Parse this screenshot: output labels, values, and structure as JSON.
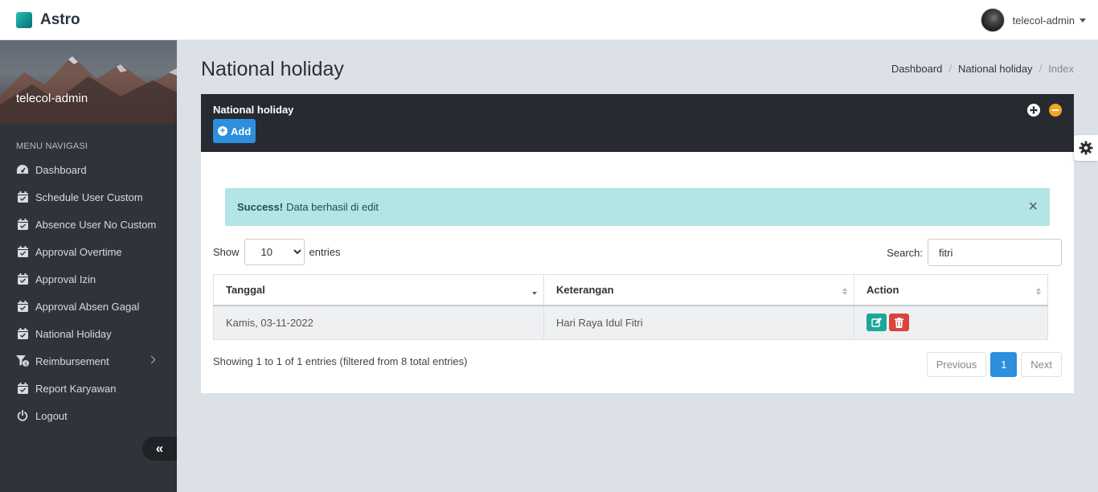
{
  "topbar": {
    "brand": "Astro",
    "user_name": "telecol-admin"
  },
  "sidebar": {
    "user_name": "telecol-admin",
    "menu_title": "MENU NAVIGASI",
    "items": [
      {
        "label": "Dashboard",
        "icon": "dashboard-icon"
      },
      {
        "label": "Schedule User Custom",
        "icon": "calendar-check-icon"
      },
      {
        "label": "Absence User No Custom",
        "icon": "calendar-check-icon"
      },
      {
        "label": "Approval Overtime",
        "icon": "calendar-check-icon"
      },
      {
        "label": "Approval Izin",
        "icon": "calendar-check-icon"
      },
      {
        "label": "Approval Absen Gagal",
        "icon": "calendar-check-icon"
      },
      {
        "label": "National Holiday",
        "icon": "calendar-check-icon"
      },
      {
        "label": "Reimbursement",
        "icon": "filter-dollar-icon"
      },
      {
        "label": "Report Karyawan",
        "icon": "calendar-check-icon"
      },
      {
        "label": "Logout",
        "icon": "power-icon"
      }
    ],
    "collapse_symbol": "«"
  },
  "page": {
    "title": "National holiday",
    "breadcrumb": [
      "Dashboard",
      "National holiday",
      "Index"
    ]
  },
  "card": {
    "title": "National holiday",
    "add_label": "Add"
  },
  "alert": {
    "strong": "Success!",
    "message": "Data berhasil di edit",
    "close": "×"
  },
  "table_controls": {
    "show_label": "Show",
    "entries_label": "entries",
    "page_length": "10",
    "search_label": "Search:",
    "search_value": "fitri"
  },
  "table": {
    "headers": [
      "Tanggal",
      "Keterangan",
      "Action"
    ],
    "rows": [
      {
        "tanggal": "Kamis, 03-11-2022",
        "keterangan": "Hari Raya Idul Fitri"
      }
    ]
  },
  "footer": {
    "info": "Showing 1 to 1 of 1 entries (filtered from 8 total entries)",
    "prev": "Previous",
    "page": "1",
    "next": "Next"
  },
  "colors": {
    "brand_teal": "#1ba89a",
    "primary_blue": "#2d8fdd",
    "alert_bg": "#b2e5e4",
    "danger": "#d9453c",
    "sidebar_bg": "#2f343a"
  }
}
